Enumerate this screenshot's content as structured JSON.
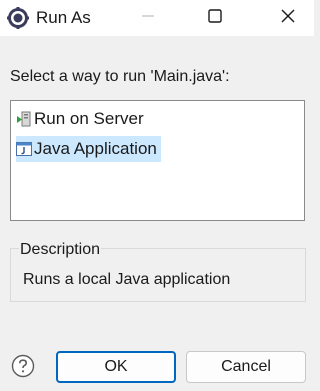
{
  "window": {
    "title": "Run As",
    "icon": "eclipse-icon",
    "controls": [
      "minimize-icon",
      "maximize-icon",
      "close-icon"
    ]
  },
  "prompt": "Select a way to run 'Main.java':",
  "launch_options": [
    {
      "label": "Run on Server",
      "icon": "run-on-server-icon",
      "selected": false
    },
    {
      "label": "Java Application",
      "icon": "java-application-icon",
      "selected": true
    }
  ],
  "description": {
    "legend": "Description",
    "text": "Runs a local Java application"
  },
  "buttons": {
    "help_icon": "help-icon",
    "ok": "OK",
    "cancel": "Cancel"
  },
  "colors": {
    "selection": "#cce8ff",
    "default_button_border": "#0067c0"
  }
}
